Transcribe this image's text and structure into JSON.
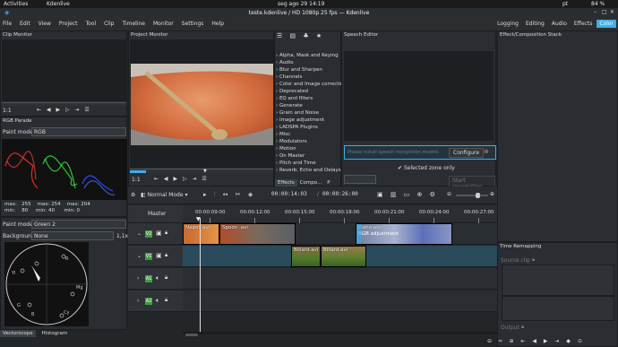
{
  "topbar": {
    "activities": "Activities",
    "app": "Kdenlive",
    "clock": "seg ago 29  14:19",
    "lang": "pt",
    "battery": "84 %"
  },
  "window": {
    "title": "teste.kdenlive / HD 1080p 25 fps — Kdenlive"
  },
  "menu": [
    "File",
    "Edit",
    "View",
    "Project",
    "Tool",
    "Clip",
    "Timeline",
    "Monitor",
    "Settings",
    "Help"
  ],
  "layouts": [
    "Logging",
    "Editing",
    "Audio",
    "Effects",
    "Color"
  ],
  "clip_monitor": {
    "title": "Clip Monitor",
    "zoom": "1:1"
  },
  "project_monitor": {
    "title": "Project Monitor",
    "zoom": "1:1"
  },
  "effects_list": {
    "items": [
      "Alpha, Mask and Keying",
      "Audio",
      "Blur and Sharpen",
      "Channels",
      "Color and Image correction",
      "Deprecated",
      "EQ and filters",
      "Generate",
      "Grain and Noise",
      "Image adjustment",
      "LADSPA Plugins",
      "Misc",
      "Modulators",
      "Motion",
      "On Master",
      "Pitch and Time",
      "Reverb, Echo and Delays"
    ],
    "tabs": [
      "Effects",
      "Compo...",
      "P"
    ]
  },
  "speech_editor": {
    "title": "Speech Editor",
    "placeholder": "Please install speech recognition models",
    "configure": "Configure",
    "selected_zone": "Selected zone only",
    "start": "Start recognition"
  },
  "effect_stack": {
    "title": "Effect/Composition Stack"
  },
  "rgb_parade": {
    "title": "RGB Parade",
    "paint_mode_label": "Paint mode:",
    "paint_mode": "RGB",
    "scale_max": "255",
    "stats": {
      "max_label": "max:",
      "min_label": "min:",
      "r_max": "255",
      "r_min": "80",
      "g_max": "254",
      "g_min": "40",
      "b_max": "204",
      "b_min": "0"
    }
  },
  "vectorscope": {
    "paint_mode_label": "Paint mode:",
    "paint_mode": "Green 2",
    "background_label": "Background:",
    "background": "None",
    "zoom": "1,1x",
    "labels": [
      "R",
      "Mg",
      "Yl",
      "Cy",
      "G",
      "B"
    ]
  },
  "bottom_tabs": [
    "Vectorscope",
    "Histogram"
  ],
  "timeline_toolbar": {
    "mode": "Normal Mode",
    "timecode": "00:00:14:03",
    "duration": "00:00:26:00"
  },
  "timeline": {
    "master": "Master",
    "ruler": [
      "00:00:09:00",
      "00:00:12:00",
      "00:00:15:00",
      "00:00:18:00",
      "00:00:21:00",
      "00:00:24:00",
      "00:00:27:00"
    ],
    "tracks": [
      "V2",
      "V1",
      "A1",
      "A2"
    ],
    "clips": [
      {
        "name": "Napoli.avi",
        "track": "V2"
      },
      {
        "name": "Spoon .avi",
        "track": "V2"
      },
      {
        "name": "Piano.avi",
        "track": "V2",
        "effect": "RGB adjustment"
      },
      {
        "name": "Billard.avi",
        "track": "V1"
      },
      {
        "name": "Billard.avi",
        "track": "V1"
      }
    ]
  },
  "time_remapping": {
    "title": "Time Remapping",
    "source": "Source clip",
    "output": "Output"
  }
}
